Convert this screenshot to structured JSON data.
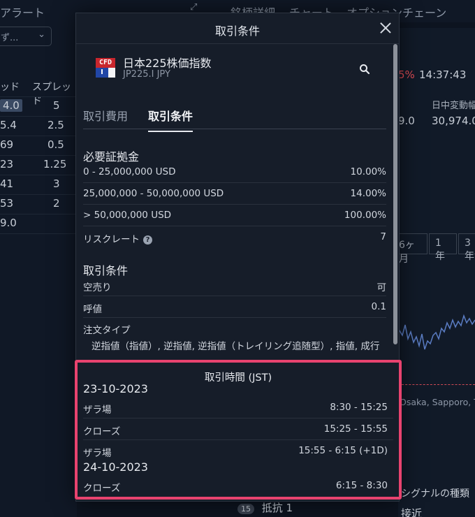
{
  "background": {
    "left_panel": {
      "title": "アラート",
      "select_text": "ず...",
      "col_headers": [
        "ッド",
        "スプレッド"
      ],
      "rows": [
        {
          "a": "4.0",
          "b": "5"
        },
        {
          "a": "5.4",
          "b": "2.5"
        },
        {
          "a": "69",
          "b": "0.5"
        },
        {
          "a": "23",
          "b": "1.25"
        },
        {
          "a": "41",
          "b": "3"
        },
        {
          "a": "53",
          "b": "2"
        },
        {
          "a": "9.0",
          "b": ""
        }
      ]
    },
    "top_tabs": [
      "銘柄詳細",
      "チャート",
      "オプションチェーン"
    ],
    "right_panel": {
      "change": "5%",
      "time": "14:37:43",
      "range_label": "日中変動幅",
      "price_a": "9.0",
      "price_b": "30,974.0",
      "period_buttons": [
        "6ヶ月",
        "1年",
        "3年"
      ],
      "exchanges": "Osaka, Sapporo, Tok",
      "signal_type": "シグナルの種類",
      "approach": "接近"
    },
    "bottom_item": {
      "badge": "15",
      "label": "抵抗 1"
    }
  },
  "modal": {
    "title": "取引条件",
    "instrument": {
      "logo_top": "CFD",
      "logo_bottom": "I",
      "name": "日本225株価指数",
      "code": "JP225.I JPY"
    },
    "tabs": [
      {
        "label": "取引費用",
        "active": false
      },
      {
        "label": "取引条件",
        "active": true
      }
    ],
    "margin": {
      "title": "必要証拠金",
      "rows": [
        {
          "label": "0 - 25,000,000 USD",
          "value": "10.00%"
        },
        {
          "label": "25,000,000 - 50,000,000 USD",
          "value": "14.00%"
        },
        {
          "label": "> 50,000,000 USD",
          "value": "100.00%"
        }
      ],
      "risk_label": "リスクレート",
      "risk_value": "7"
    },
    "conditions": {
      "title": "取引条件",
      "rows": [
        {
          "label": "空売り",
          "value": "可"
        },
        {
          "label": "呼値",
          "value": "0.1"
        }
      ],
      "order_type_label": "注文タイプ",
      "order_type_value": "逆指値（指値）, 逆指値, 逆指値（トレイリング追随型）, 指値, 成行"
    },
    "hours": {
      "title": "取引時間 (JST)",
      "day1": "23-10-2023",
      "day1_rows": [
        {
          "label": "ザラ場",
          "value": "8:30 - 15:25"
        },
        {
          "label": "クローズ",
          "value": "15:25 - 15:55"
        },
        {
          "label": "ザラ場",
          "value": "15:55 - 6:15 (+1D)"
        }
      ],
      "day2": "24-10-2023",
      "day2_rows": [
        {
          "label": "クローズ",
          "value": "6:15 - 8:30"
        }
      ]
    }
  },
  "colors": {
    "highlight_border": "#e8436f",
    "modal_bg": "#161d29",
    "app_bg": "#0d1420",
    "logo_red": "#c8262d",
    "logo_blue": "#2146a6"
  }
}
